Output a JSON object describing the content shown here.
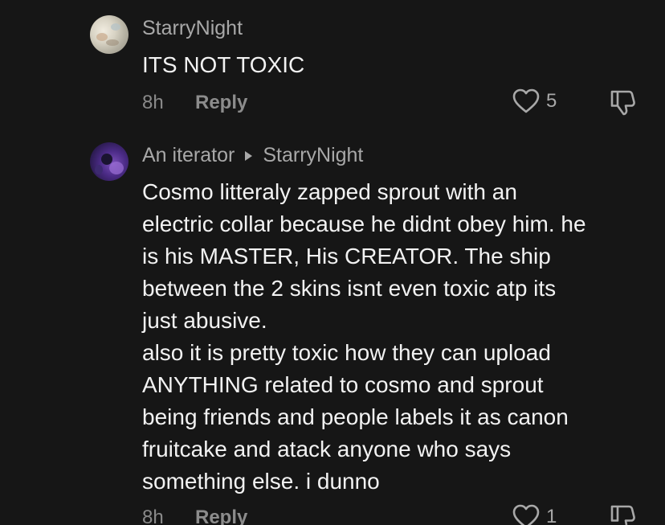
{
  "comments": [
    {
      "username": "StarryNight",
      "reply_to": "",
      "text": "ITS NOT TOXIC",
      "time": "8h",
      "reply_label": "Reply",
      "likes": "5"
    },
    {
      "username": "An iterator",
      "reply_to": "StarryNight",
      "text": "Cosmo litteraly zapped sprout with an\nelectric collar because he didnt obey him. he\nis his MASTER, His CREATOR. The ship\nbetween the 2 skins isnt even toxic atp its\njust abusive.\nalso it is pretty toxic how they can upload\nANYTHING related to cosmo and sprout\nbeing friends and people labels it as canon\nfruitcake and atack anyone who says\nsomething else. i dunno",
      "time": "8h",
      "reply_label": "Reply",
      "likes": "1"
    }
  ],
  "icons": {
    "like": "heart-outline-icon",
    "dislike": "thumbs-down-outline-icon",
    "reply_to_arrow": "caret-right-icon"
  },
  "colors": {
    "background": "#161616",
    "username": "#a8a8a8",
    "text": "#f2f2f2",
    "meta": "#8a8a8a"
  }
}
